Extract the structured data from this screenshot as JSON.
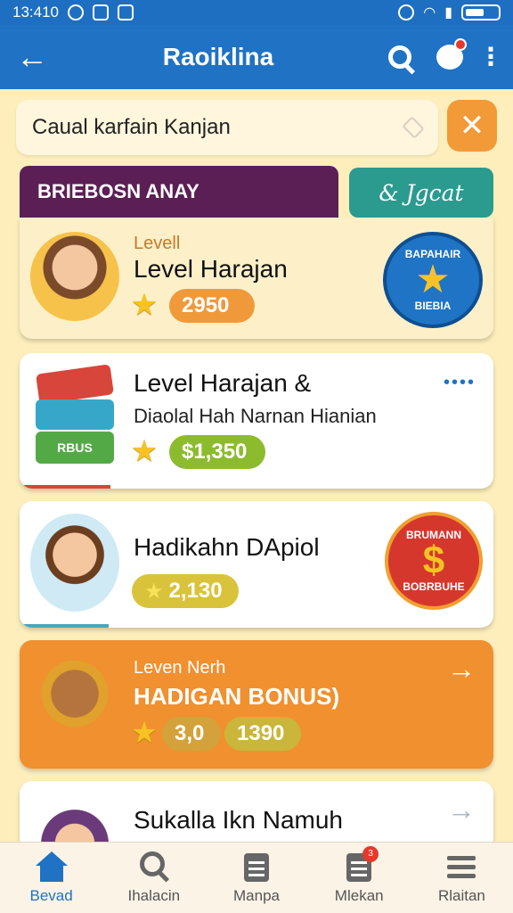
{
  "status": {
    "time": "13:410"
  },
  "appbar": {
    "title": "Raoiklina"
  },
  "search": {
    "value": "Caual karfain Kanjan"
  },
  "tabs": {
    "active": "BRIEBOSN ANAY",
    "other": "& Jgcat"
  },
  "cards": [
    {
      "small": "Levell",
      "title": "Level Harajan",
      "value": "2950",
      "badge_top": "BAPAHAIR",
      "badge_bottom": "BIEBIA"
    },
    {
      "title": "Level Harajan &",
      "subtitle": "Diaolal Hah Narnan Hianian",
      "value": "$1,350",
      "more": "••••",
      "book_label": "RBUS"
    },
    {
      "title": "Hadikahn DApiol",
      "value": "2,130",
      "badge_top": "BRUMANN",
      "badge_bottom": "BOBRBUHE"
    },
    {
      "small": "Leven Nerh",
      "title": "HADIGAN BONUS)",
      "value_a": "3,0",
      "value_b": "1390",
      "arrow": "→"
    },
    {
      "title": "Sukalla Ikn Namuh",
      "arrow": "→"
    }
  ],
  "nav": [
    {
      "label": "Bevad",
      "icon": "home-icon"
    },
    {
      "label": "Ihalacin",
      "icon": "search-icon"
    },
    {
      "label": "Manpa",
      "icon": "clipboard-icon"
    },
    {
      "label": "Mlekan",
      "icon": "notes-icon",
      "badge": "3"
    },
    {
      "label": "Rlaitan",
      "icon": "menu-icon"
    }
  ],
  "colors": {
    "primary": "#1f72c4",
    "accent": "#f29a38",
    "tab_active": "#5b1f55",
    "tab_other": "#2b9a8f"
  }
}
